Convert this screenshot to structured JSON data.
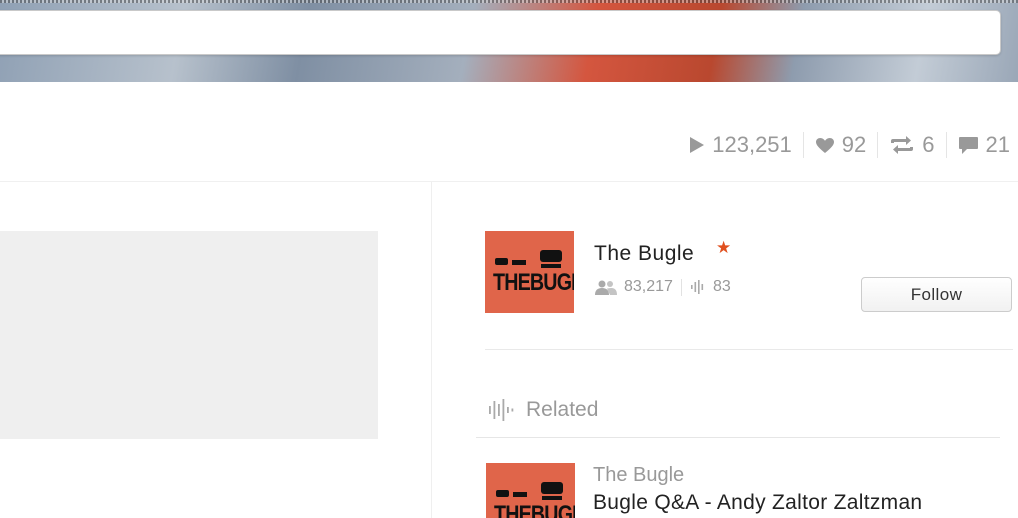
{
  "stats": {
    "plays": "123,251",
    "likes": "92",
    "reposts": "6",
    "comments": "21"
  },
  "user": {
    "name": "The Bugle",
    "pro_star": "★",
    "followers": "83,217",
    "tracks": "83",
    "avatar_text": "THEBUGLE",
    "follow_label": "Follow"
  },
  "related": {
    "heading": "Related",
    "item": {
      "user": "The Bugle",
      "title": "Bugle Q&A - Andy Zaltor Zaltzman",
      "avatar_text": "THEBUGLE"
    }
  },
  "colors": {
    "accent": "#e0501f",
    "avatar_bg": "#e0654a",
    "muted": "#999999"
  },
  "icons": [
    "play-icon",
    "heart-icon",
    "repost-icon",
    "comment-icon",
    "followers-icon",
    "tracks-icon",
    "related-icon"
  ]
}
